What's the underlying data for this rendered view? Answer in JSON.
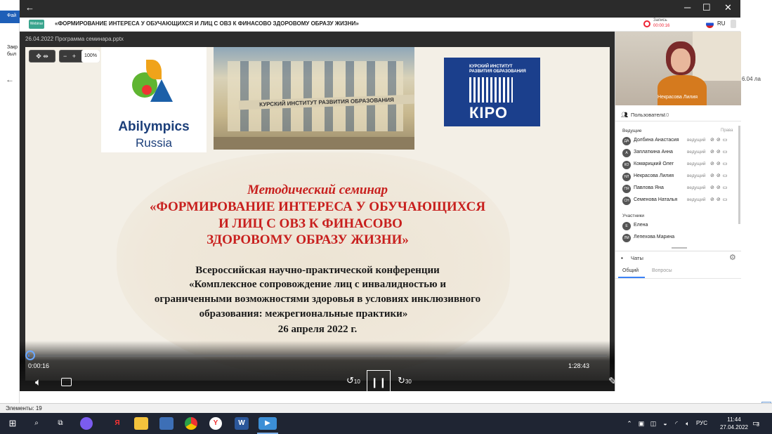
{
  "window": {
    "meeting_title": "«ФОРМИРОВАНИЕ ИНТЕРЕСА У ОБУЧАЮЩИХСЯ И ЛИЦ С ОВЗ К ФИНАСОВО ЗДОРОВОМУ ОБРАЗУ ЖИЗНИ»",
    "logo_text": "Webinar"
  },
  "recording": {
    "label": "Запись",
    "time": "00:00:16",
    "lang": "RU"
  },
  "slide_file": "26.04.2022 Программа семинара.pptx",
  "zoom": {
    "minus": "−",
    "plus": "+",
    "percent": "100%"
  },
  "slide": {
    "abilympics": "Abilympics",
    "russia": "Russia",
    "building_sign": "КУРСКИЙ ИНСТИТУТ РАЗВИТИЯ ОБРАЗОВАНИЯ",
    "kiro_line1": "КУРСКИЙ ИНСТИТУТ",
    "kiro_line2": "РАЗВИТИЯ ОБРАЗОВАНИЯ",
    "kiro_logo": "КIРО",
    "heading": "Методический семинар",
    "title1": "«ФОРМИРОВАНИЕ ИНТЕРЕСА У ОБУЧАЮЩИХСЯ",
    "title2": "И ЛИЦ С ОВЗ К ФИНАСОВО",
    "title3": "ЗДОРОВОМУ ОБРАЗУ ЖИЗНИ»",
    "conf1": "Всероссийская  научно-практической конференции",
    "conf2": "«Комплексное сопровождение лиц с инвалидностью и",
    "conf3": "ограниченными возможностями здоровья в условиях инклюзивного",
    "conf4": "образования: межрегиональные практики»",
    "date": "26 апреля 2022 г."
  },
  "player": {
    "current": "0:00:16",
    "total": "1:28:43",
    "progress": 0.003,
    "skip_back": "10",
    "skip_fwd": "30",
    "deg": "360"
  },
  "webcam": {
    "name": "Некрасова Лилия"
  },
  "users": {
    "title": "Пользователи",
    "count": "10",
    "hosts_label": "Ведущие",
    "rights_label": "Права",
    "participants_label": "Участники",
    "hosts": [
      {
        "initials": "ДА",
        "name": "Долбина Анастасия",
        "role": "ведущий"
      },
      {
        "initials": "А",
        "name": "Заплаткина Анна",
        "role": "ведущий"
      },
      {
        "initials": "КО",
        "name": "Комарицкий Олег",
        "role": "ведущий"
      },
      {
        "initials": "НЛ",
        "name": "Некрасова Лилия",
        "role": "ведущий"
      },
      {
        "initials": "ПЯ",
        "name": "Павлова Яна",
        "role": "ведущий"
      },
      {
        "initials": "СН",
        "name": "Семенова Наталья",
        "role": "ведущий"
      }
    ],
    "participants": [
      {
        "initials": "Е",
        "name": "Елена"
      },
      {
        "initials": "ЛМ",
        "name": "Лепехова Марина"
      }
    ]
  },
  "chats": {
    "title": "Чаты",
    "tab_general": "Общий",
    "tab_questions": "Вопросы"
  },
  "statusbar": {
    "elements": "Элементы: 19"
  },
  "taskbar": {
    "lang": "РУС",
    "time": "11:44",
    "date": "27.04.2022",
    "notif": "3"
  },
  "background": {
    "left1": "Фай",
    "left2": "Закр",
    "left3": "был",
    "right1": "6.04 ла"
  }
}
